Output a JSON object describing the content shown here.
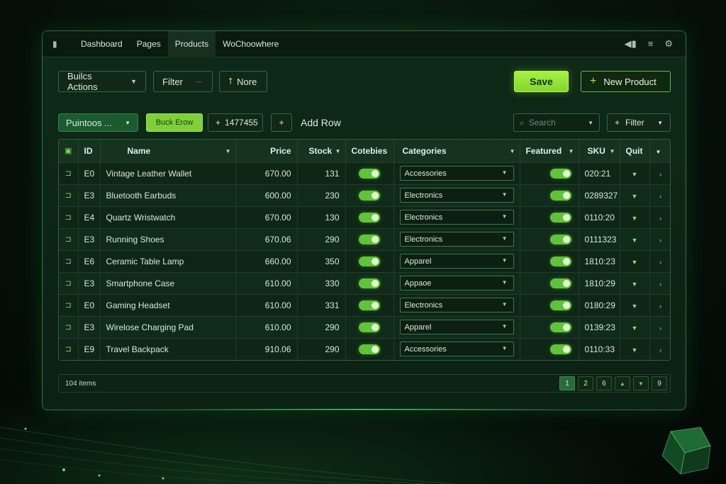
{
  "topnav": {
    "tabs": [
      {
        "label": "Dashboard"
      },
      {
        "label": "Pages"
      },
      {
        "label": "Products",
        "active": true
      },
      {
        "label": "WoChoowhere"
      }
    ]
  },
  "toolbar": {
    "bulk_actions_label": "Builcs Actions",
    "filter_label": "Filter",
    "more_label": "Nore",
    "save_label": "Save",
    "new_product_label": "New Product"
  },
  "subbar": {
    "profiles_label": "Puintoos ...",
    "bulk_row_label": "Buck Erow",
    "count_label": "1477455",
    "add_row_label": "Add Row",
    "search_placeholder": "Search",
    "filter_label": "Filter"
  },
  "table": {
    "columns": [
      "ID",
      "Name",
      "Price",
      "Stock",
      "Cotebies",
      "Categories",
      "Featured",
      "SKU",
      "Quit"
    ],
    "rows": [
      {
        "id": "E0",
        "name": "Vintage Leather Wallet",
        "price": "670.00",
        "stock": "131",
        "category": "Accessories",
        "sku": "020:21"
      },
      {
        "id": "E3",
        "name": "Bluetooth Earbuds",
        "price": "600.00",
        "stock": "230",
        "category": "Electronics",
        "sku": "0289327"
      },
      {
        "id": "E4",
        "name": "Quartz Wristwatch",
        "price": "670.00",
        "stock": "130",
        "category": "Electronics",
        "sku": "0110:20"
      },
      {
        "id": "E3",
        "name": "Running Shoes",
        "price": "670.06",
        "stock": "290",
        "category": "Electronics",
        "sku": "0111323"
      },
      {
        "id": "E6",
        "name": "Ceramic Table Lamp",
        "price": "660.00",
        "stock": "350",
        "category": "Apparel",
        "sku": "1810:23"
      },
      {
        "id": "E3",
        "name": "Smartphone Case",
        "price": "610.00",
        "stock": "330",
        "category": "Appaoe",
        "sku": "1810:29"
      },
      {
        "id": "E0",
        "name": "Gaming Headset",
        "price": "610.00",
        "stock": "331",
        "category": "Electronics",
        "sku": "0180:29"
      },
      {
        "id": "E3",
        "name": "Wirelose Charging Pad",
        "price": "610.00",
        "stock": "290",
        "category": "Apparel",
        "sku": "0139:23"
      },
      {
        "id": "E9",
        "name": "Travel Backpack",
        "price": "910.06",
        "stock": "290",
        "category": "Accessories",
        "sku": "0110:33"
      }
    ]
  },
  "footer": {
    "count_label": "104 items",
    "pages": [
      "1",
      "2",
      "6",
      "9"
    ]
  },
  "colors": {
    "accent": "#8fe03a",
    "panel": "#0f2a18",
    "border": "#2e6b3d"
  }
}
